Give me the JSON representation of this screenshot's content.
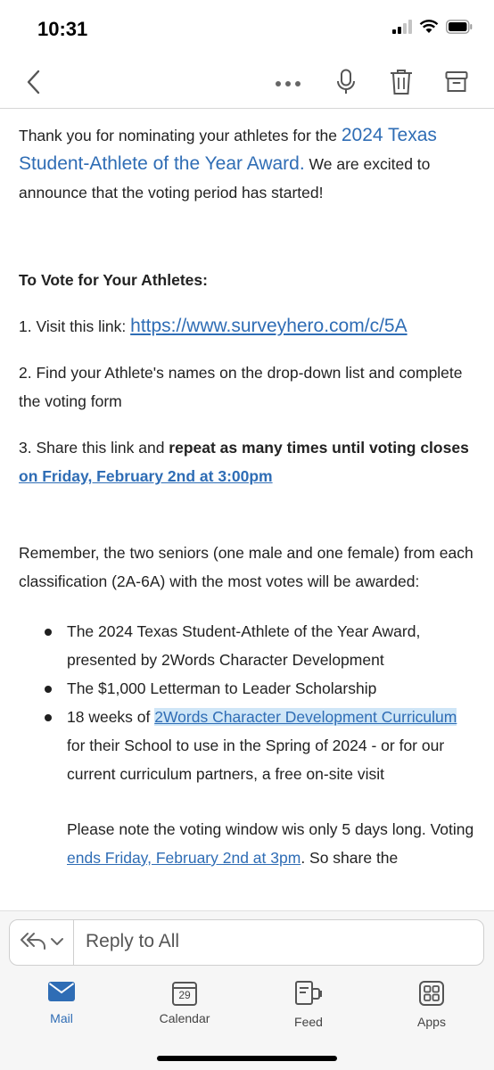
{
  "status_bar": {
    "time": "10:31"
  },
  "body": {
    "intro_pre": "Thank you for nominating your athletes for the ",
    "award_link": "2024 Texas Student-Athlete of the Year Award.",
    "intro_post": " We are excited to announce that the voting period has started!",
    "vote_heading": "To Vote for Your Athletes:",
    "step1_pre": "1. Visit this link: ",
    "step1_link": "https://www.surveyhero.com/c/5A",
    "step2": "2. Find your Athlete's names on the drop-down list and complete the voting form",
    "step3_pre": "3. Share this link and ",
    "step3_bold": "repeat as many times until voting closes",
    "step3_link": "on Friday, February 2nd at 3:00pm",
    "remember": "Remember, the two seniors (one male and one female) from each classification (2A-6A) with the most votes will be awarded:",
    "bullet1": "The 2024 Texas Student-Athlete of the Year Award, presented by 2Words Character Development",
    "bullet2": "The $1,000 Letterman to Leader Scholarship",
    "bullet3_pre": "18 weeks of ",
    "bullet3_link": "2Words Character Development Curriculum",
    "bullet3_post": " for their School to use in the Spring of 2024 - or for our current curriculum partners, a free on-site visit",
    "note_pre": "Please note the voting window wis only 5 days long. Voting ",
    "note_link": "ends Friday, February 2nd at 3pm",
    "note_post": ". So share the"
  },
  "reply": {
    "placeholder": "Reply to All"
  },
  "tabs": [
    {
      "label": "Mail",
      "icon": "mail-icon",
      "active": true
    },
    {
      "label": "Calendar",
      "icon": "calendar-icon",
      "day": "29"
    },
    {
      "label": "Feed",
      "icon": "feed-icon"
    },
    {
      "label": "Apps",
      "icon": "apps-icon"
    }
  ],
  "colors": {
    "accent": "#2f6db5",
    "highlight": "#cfe6f7",
    "bar_bg": "#f6f6f6"
  }
}
